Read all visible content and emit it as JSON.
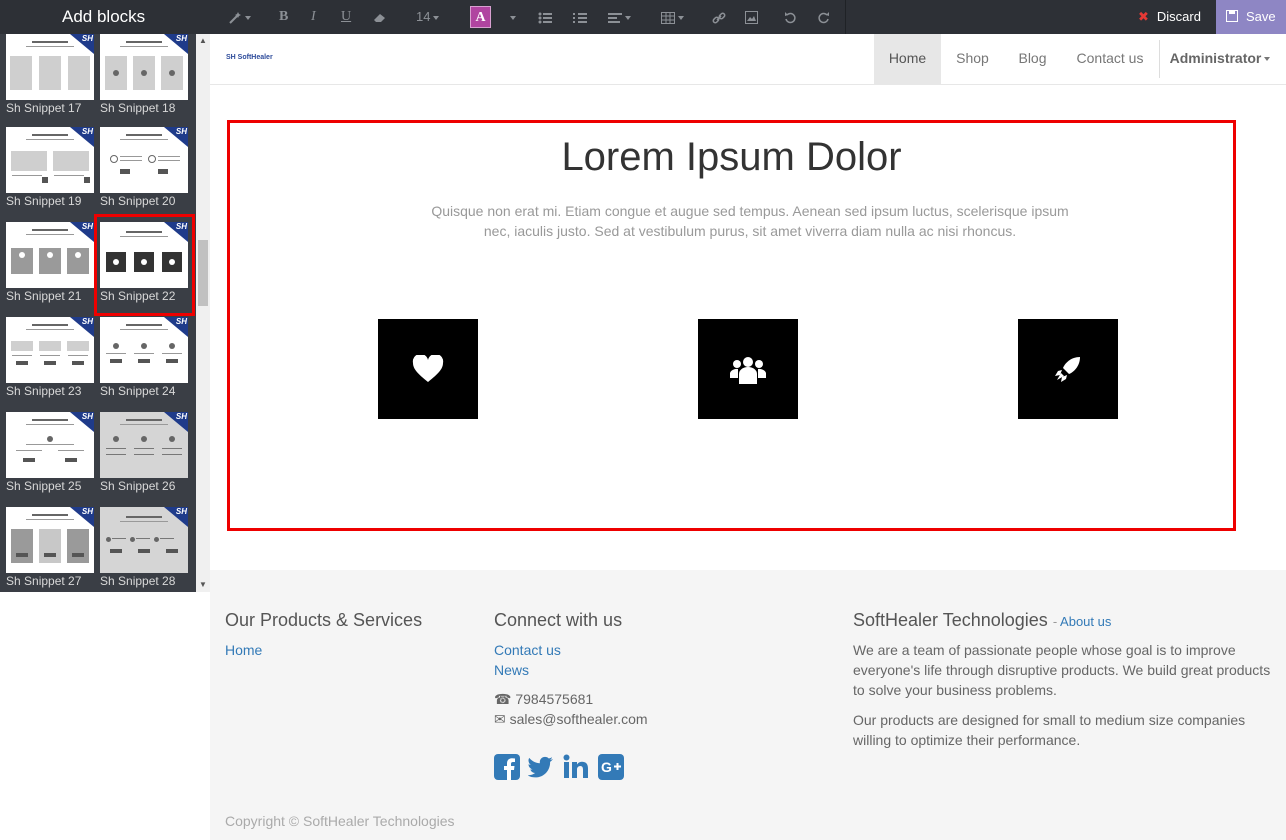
{
  "sidebar": {
    "title": "Add blocks",
    "blocks": [
      {
        "label": "Sh Snippet 17"
      },
      {
        "label": "Sh Snippet 18"
      },
      {
        "label": "Sh Snippet 19"
      },
      {
        "label": "Sh Snippet 20"
      },
      {
        "label": "Sh Snippet 21"
      },
      {
        "label": "Sh Snippet 22",
        "selected": true
      },
      {
        "label": "Sh Snippet 23"
      },
      {
        "label": "Sh Snippet 24"
      },
      {
        "label": "Sh Snippet 25"
      },
      {
        "label": "Sh Snippet 26"
      },
      {
        "label": "Sh Snippet 27"
      },
      {
        "label": "Sh Snippet 28"
      }
    ],
    "thumb_badge": "SH"
  },
  "toolbar": {
    "font_size": "14",
    "color_letter": "A",
    "discard_label": "Discard",
    "save_label": "Save",
    "icons": [
      "magic-icon",
      "bold-icon",
      "italic-icon",
      "underline-icon",
      "eraser-icon",
      "font-size-dropdown",
      "font-color-icon",
      "unordered-list-icon",
      "ordered-list-icon",
      "align-icon",
      "table-icon",
      "link-icon",
      "image-icon",
      "undo-icon",
      "redo-icon"
    ],
    "colors": {
      "save_bg": "#8e86c4",
      "discard_x": "#e53935",
      "font_color_bg": "#b044a0"
    }
  },
  "nav": {
    "logo": "SH SoftHealer",
    "items": [
      "Home",
      "Shop",
      "Blog",
      "Contact us"
    ],
    "active": "Home",
    "user": "Administrator"
  },
  "hero": {
    "title": "Lorem Ipsum Dolor",
    "text": "Quisque non erat mi. Etiam congue et augue sed tempus. Aenean sed ipsum luctus, scelerisque ipsum nec, iaculis justo. Sed at vestibulum purus, sit amet viverra diam nulla ac nisi rhoncus.",
    "features": [
      "heart-icon",
      "users-icon",
      "rocket-icon"
    ]
  },
  "footer": {
    "col1": {
      "title": "Our Products & Services",
      "links": [
        "Home"
      ]
    },
    "col2": {
      "title": "Connect with us",
      "links": [
        "Contact us",
        "News"
      ],
      "phone": "7984575681",
      "email": "sales@softhealer.com",
      "social": [
        "facebook-icon",
        "twitter-icon",
        "linkedin-icon",
        "google-plus-icon"
      ]
    },
    "col3": {
      "title": "SoftHealer Technologies",
      "about_link": "About us",
      "para1": "We are a team of passionate people whose goal is to improve everyone's life through disruptive products. We build great products to solve your business problems.",
      "para2": "Our products are designed for small to medium size companies willing to optimize their performance."
    },
    "copyright": "Copyright © SoftHealer Technologies",
    "colors": {
      "link": "#337ab7",
      "social": "#337ab7"
    }
  }
}
